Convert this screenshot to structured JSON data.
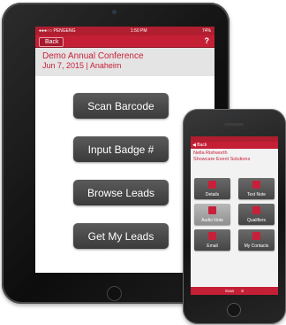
{
  "tablet": {
    "status": {
      "carrier": "●●●○○ PENGENG",
      "time": "1:50 PM",
      "battery": "74%"
    },
    "nav": {
      "back_label": "Back",
      "help_label": "?"
    },
    "event": {
      "name": "Demo Annual Conference",
      "date": "Jun 7, 2015 | Anaheim"
    },
    "buttons": [
      "Scan Barcode",
      "Input Badge #",
      "Browse Leads",
      "Get My Leads"
    ]
  },
  "phone": {
    "nav": {
      "back_label": "◀ Back"
    },
    "contact": {
      "name": "Nella Rishworth",
      "company": "Showcare Event Solutions"
    },
    "tiles": [
      "Details",
      "Text Note",
      "Audio Note",
      "Qualifiers",
      "Email",
      "My Contacts"
    ],
    "bottom": {
      "scan": "Scan",
      "other": "S"
    }
  },
  "colors": {
    "accent": "#c41f35",
    "button": "#4a4a4a"
  }
}
